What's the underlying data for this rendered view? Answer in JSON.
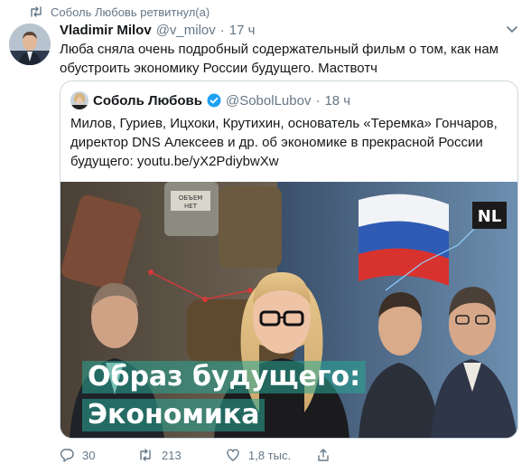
{
  "retweet": {
    "icon": "retweet-icon",
    "text": "Соболь Любовь ретвитнул(а)"
  },
  "tweet": {
    "author_name": "Vladimir Milov",
    "author_handle": "@v_milov",
    "separator": "·",
    "time": "17 ч",
    "text": "Люба сняла очень подробный содержательный фильм о том, как нам обустроить экономику России будущего. Маствотч"
  },
  "quoted": {
    "author_name": "Соболь Любовь",
    "verified_icon": "verified-badge-icon",
    "author_handle": "@SobolLubov",
    "separator": "·",
    "time": "18 ч",
    "text": "Милов, Гуриев, Ицхоки, Крутихин, основатель «Теремка» Гончаров, директор DNS Алексеев и др. об экономике в прекрасной России будущего: youtu.be/yX2PdiybwXw",
    "media": {
      "headline_line1": "Образ будущего:",
      "headline_line2": "Экономика",
      "logo_text": "NL",
      "barrel_label_1": "ОБЪЕМ",
      "barrel_label_2": "НЕТ"
    }
  },
  "actions": {
    "reply_count": "30",
    "retweet_count": "213",
    "like_count": "1,8 тыс.",
    "icons": [
      "reply-icon",
      "retweet-icon",
      "like-icon",
      "share-icon"
    ]
  },
  "colors": {
    "text": "#14171a",
    "secondary": "#657786",
    "border": "#ccd6dd",
    "verified": "#1da1f2",
    "headline_bg": "#28a896"
  }
}
